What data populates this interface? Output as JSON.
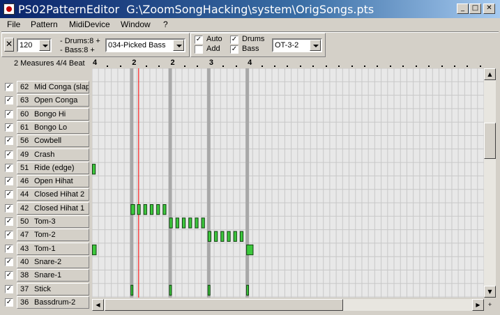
{
  "window": {
    "app_name": "PS02PatternEditor",
    "file_path": "G:\\ZoomSongHacking\\system\\OrigSongs.pts",
    "btn_minimize": "_",
    "btn_maximize": "□",
    "btn_close": "✕"
  },
  "menu": [
    "File",
    "Pattern",
    "MidiDevice",
    "Window",
    "?"
  ],
  "toolbar": {
    "mute_glyph": "✕",
    "tempo_value": "120",
    "drums_label": "- Drums:8 +",
    "bass_label": "- Bass:8 +",
    "instrument_value": "034-Picked Bass",
    "auto_label": "Auto",
    "auto_checked": "✓",
    "add_label": "Add",
    "add_checked": "",
    "drums_check_label": "Drums",
    "drums_checked": "✓",
    "bass_check_label": "Bass",
    "bass_checked": "✓",
    "preset_value": "OT-3-2"
  },
  "info": {
    "measures_label": "2 Measures  4/4 Beat"
  },
  "ruler": {
    "start_label": "4",
    "beat_labels": [
      "2",
      "2",
      "3",
      "4"
    ]
  },
  "tracks": [
    {
      "num": "62",
      "name": "Mid Conga (slap)",
      "checked": "✓"
    },
    {
      "num": "63",
      "name": "Open Conga",
      "checked": "✓"
    },
    {
      "num": "60",
      "name": "Bongo Hi",
      "checked": "✓"
    },
    {
      "num": "61",
      "name": "Bongo Lo",
      "checked": "✓"
    },
    {
      "num": "56",
      "name": "Cowbell",
      "checked": "✓"
    },
    {
      "num": "49",
      "name": "Crash",
      "checked": "✓"
    },
    {
      "num": "51",
      "name": "Ride (edge)",
      "checked": "✓"
    },
    {
      "num": "46",
      "name": "Open Hihat",
      "checked": "✓"
    },
    {
      "num": "44",
      "name": "Closed Hihat 2",
      "checked": "✓"
    },
    {
      "num": "42",
      "name": "Closed Hihat 1",
      "checked": "✓"
    },
    {
      "num": "50",
      "name": "Tom-3",
      "checked": "✓"
    },
    {
      "num": "47",
      "name": "Tom-2",
      "checked": "✓"
    },
    {
      "num": "43",
      "name": "Tom-1",
      "checked": "✓"
    },
    {
      "num": "40",
      "name": "Snare-2",
      "checked": "✓"
    },
    {
      "num": "38",
      "name": "Snare-1",
      "checked": "✓"
    },
    {
      "num": "37",
      "name": "Stick",
      "checked": "✓"
    },
    {
      "num": "36",
      "name": "Bassdrum-2",
      "checked": "✓"
    }
  ],
  "colors": {
    "grid_bg": "#e8e8e8",
    "grid_line": "#c8c8c8",
    "beat_bar": "#a8a8a8",
    "note_green": "#3cc83c",
    "note_dark": "#104010",
    "playhead": "#ff0000"
  },
  "pattern": {
    "steps_visible": 61,
    "beat_steps": [
      6,
      12,
      18,
      24
    ],
    "playhead_step": 6.6,
    "notes": [
      {
        "track": 7,
        "step": 0,
        "len": 0.4
      },
      {
        "track": 13,
        "step": 0,
        "len": 0.5
      },
      {
        "track": 10,
        "step": 6,
        "len": 0.5
      },
      {
        "track": 10,
        "step": 7,
        "len": 0.4
      },
      {
        "track": 10,
        "step": 8,
        "len": 0.4
      },
      {
        "track": 10,
        "step": 9,
        "len": 0.4
      },
      {
        "track": 10,
        "step": 10,
        "len": 0.4
      },
      {
        "track": 10,
        "step": 11,
        "len": 0.4
      },
      {
        "track": 16,
        "step": 6,
        "len": 0.3
      },
      {
        "track": 11,
        "step": 12,
        "len": 0.4
      },
      {
        "track": 11,
        "step": 13,
        "len": 0.4
      },
      {
        "track": 11,
        "step": 14,
        "len": 0.4
      },
      {
        "track": 11,
        "step": 15,
        "len": 0.4
      },
      {
        "track": 11,
        "step": 16,
        "len": 0.4
      },
      {
        "track": 11,
        "step": 17,
        "len": 0.4
      },
      {
        "track": 16,
        "step": 12,
        "len": 0.3
      },
      {
        "track": 12,
        "step": 18,
        "len": 0.4
      },
      {
        "track": 12,
        "step": 19,
        "len": 0.4
      },
      {
        "track": 12,
        "step": 20,
        "len": 0.4
      },
      {
        "track": 12,
        "step": 21,
        "len": 0.4
      },
      {
        "track": 12,
        "step": 22,
        "len": 0.4
      },
      {
        "track": 12,
        "step": 23,
        "len": 0.4
      },
      {
        "track": 16,
        "step": 18,
        "len": 0.3
      },
      {
        "track": 13,
        "step": 24,
        "len": 0.8
      },
      {
        "track": 16,
        "step": 24,
        "len": 0.3
      }
    ]
  }
}
